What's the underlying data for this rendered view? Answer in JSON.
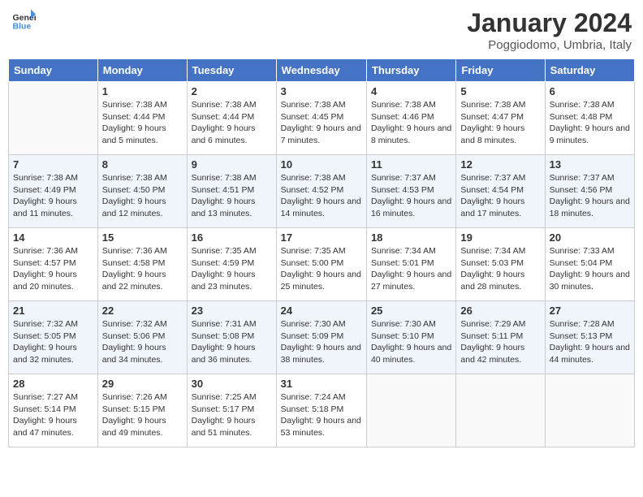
{
  "header": {
    "logo": {
      "text_general": "General",
      "text_blue": "Blue"
    },
    "title": "January 2024",
    "location": "Poggiodomo, Umbria, Italy"
  },
  "weekdays": [
    "Sunday",
    "Monday",
    "Tuesday",
    "Wednesday",
    "Thursday",
    "Friday",
    "Saturday"
  ],
  "weeks": [
    [
      {
        "day": "",
        "sunrise": "",
        "sunset": "",
        "daylight": ""
      },
      {
        "day": "1",
        "sunrise": "Sunrise: 7:38 AM",
        "sunset": "Sunset: 4:44 PM",
        "daylight": "Daylight: 9 hours and 5 minutes."
      },
      {
        "day": "2",
        "sunrise": "Sunrise: 7:38 AM",
        "sunset": "Sunset: 4:44 PM",
        "daylight": "Daylight: 9 hours and 6 minutes."
      },
      {
        "day": "3",
        "sunrise": "Sunrise: 7:38 AM",
        "sunset": "Sunset: 4:45 PM",
        "daylight": "Daylight: 9 hours and 7 minutes."
      },
      {
        "day": "4",
        "sunrise": "Sunrise: 7:38 AM",
        "sunset": "Sunset: 4:46 PM",
        "daylight": "Daylight: 9 hours and 8 minutes."
      },
      {
        "day": "5",
        "sunrise": "Sunrise: 7:38 AM",
        "sunset": "Sunset: 4:47 PM",
        "daylight": "Daylight: 9 hours and 8 minutes."
      },
      {
        "day": "6",
        "sunrise": "Sunrise: 7:38 AM",
        "sunset": "Sunset: 4:48 PM",
        "daylight": "Daylight: 9 hours and 9 minutes."
      }
    ],
    [
      {
        "day": "7",
        "sunrise": "Sunrise: 7:38 AM",
        "sunset": "Sunset: 4:49 PM",
        "daylight": "Daylight: 9 hours and 11 minutes."
      },
      {
        "day": "8",
        "sunrise": "Sunrise: 7:38 AM",
        "sunset": "Sunset: 4:50 PM",
        "daylight": "Daylight: 9 hours and 12 minutes."
      },
      {
        "day": "9",
        "sunrise": "Sunrise: 7:38 AM",
        "sunset": "Sunset: 4:51 PM",
        "daylight": "Daylight: 9 hours and 13 minutes."
      },
      {
        "day": "10",
        "sunrise": "Sunrise: 7:38 AM",
        "sunset": "Sunset: 4:52 PM",
        "daylight": "Daylight: 9 hours and 14 minutes."
      },
      {
        "day": "11",
        "sunrise": "Sunrise: 7:37 AM",
        "sunset": "Sunset: 4:53 PM",
        "daylight": "Daylight: 9 hours and 16 minutes."
      },
      {
        "day": "12",
        "sunrise": "Sunrise: 7:37 AM",
        "sunset": "Sunset: 4:54 PM",
        "daylight": "Daylight: 9 hours and 17 minutes."
      },
      {
        "day": "13",
        "sunrise": "Sunrise: 7:37 AM",
        "sunset": "Sunset: 4:56 PM",
        "daylight": "Daylight: 9 hours and 18 minutes."
      }
    ],
    [
      {
        "day": "14",
        "sunrise": "Sunrise: 7:36 AM",
        "sunset": "Sunset: 4:57 PM",
        "daylight": "Daylight: 9 hours and 20 minutes."
      },
      {
        "day": "15",
        "sunrise": "Sunrise: 7:36 AM",
        "sunset": "Sunset: 4:58 PM",
        "daylight": "Daylight: 9 hours and 22 minutes."
      },
      {
        "day": "16",
        "sunrise": "Sunrise: 7:35 AM",
        "sunset": "Sunset: 4:59 PM",
        "daylight": "Daylight: 9 hours and 23 minutes."
      },
      {
        "day": "17",
        "sunrise": "Sunrise: 7:35 AM",
        "sunset": "Sunset: 5:00 PM",
        "daylight": "Daylight: 9 hours and 25 minutes."
      },
      {
        "day": "18",
        "sunrise": "Sunrise: 7:34 AM",
        "sunset": "Sunset: 5:01 PM",
        "daylight": "Daylight: 9 hours and 27 minutes."
      },
      {
        "day": "19",
        "sunrise": "Sunrise: 7:34 AM",
        "sunset": "Sunset: 5:03 PM",
        "daylight": "Daylight: 9 hours and 28 minutes."
      },
      {
        "day": "20",
        "sunrise": "Sunrise: 7:33 AM",
        "sunset": "Sunset: 5:04 PM",
        "daylight": "Daylight: 9 hours and 30 minutes."
      }
    ],
    [
      {
        "day": "21",
        "sunrise": "Sunrise: 7:32 AM",
        "sunset": "Sunset: 5:05 PM",
        "daylight": "Daylight: 9 hours and 32 minutes."
      },
      {
        "day": "22",
        "sunrise": "Sunrise: 7:32 AM",
        "sunset": "Sunset: 5:06 PM",
        "daylight": "Daylight: 9 hours and 34 minutes."
      },
      {
        "day": "23",
        "sunrise": "Sunrise: 7:31 AM",
        "sunset": "Sunset: 5:08 PM",
        "daylight": "Daylight: 9 hours and 36 minutes."
      },
      {
        "day": "24",
        "sunrise": "Sunrise: 7:30 AM",
        "sunset": "Sunset: 5:09 PM",
        "daylight": "Daylight: 9 hours and 38 minutes."
      },
      {
        "day": "25",
        "sunrise": "Sunrise: 7:30 AM",
        "sunset": "Sunset: 5:10 PM",
        "daylight": "Daylight: 9 hours and 40 minutes."
      },
      {
        "day": "26",
        "sunrise": "Sunrise: 7:29 AM",
        "sunset": "Sunset: 5:11 PM",
        "daylight": "Daylight: 9 hours and 42 minutes."
      },
      {
        "day": "27",
        "sunrise": "Sunrise: 7:28 AM",
        "sunset": "Sunset: 5:13 PM",
        "daylight": "Daylight: 9 hours and 44 minutes."
      }
    ],
    [
      {
        "day": "28",
        "sunrise": "Sunrise: 7:27 AM",
        "sunset": "Sunset: 5:14 PM",
        "daylight": "Daylight: 9 hours and 47 minutes."
      },
      {
        "day": "29",
        "sunrise": "Sunrise: 7:26 AM",
        "sunset": "Sunset: 5:15 PM",
        "daylight": "Daylight: 9 hours and 49 minutes."
      },
      {
        "day": "30",
        "sunrise": "Sunrise: 7:25 AM",
        "sunset": "Sunset: 5:17 PM",
        "daylight": "Daylight: 9 hours and 51 minutes."
      },
      {
        "day": "31",
        "sunrise": "Sunrise: 7:24 AM",
        "sunset": "Sunset: 5:18 PM",
        "daylight": "Daylight: 9 hours and 53 minutes."
      },
      {
        "day": "",
        "sunrise": "",
        "sunset": "",
        "daylight": ""
      },
      {
        "day": "",
        "sunrise": "",
        "sunset": "",
        "daylight": ""
      },
      {
        "day": "",
        "sunrise": "",
        "sunset": "",
        "daylight": ""
      }
    ]
  ]
}
